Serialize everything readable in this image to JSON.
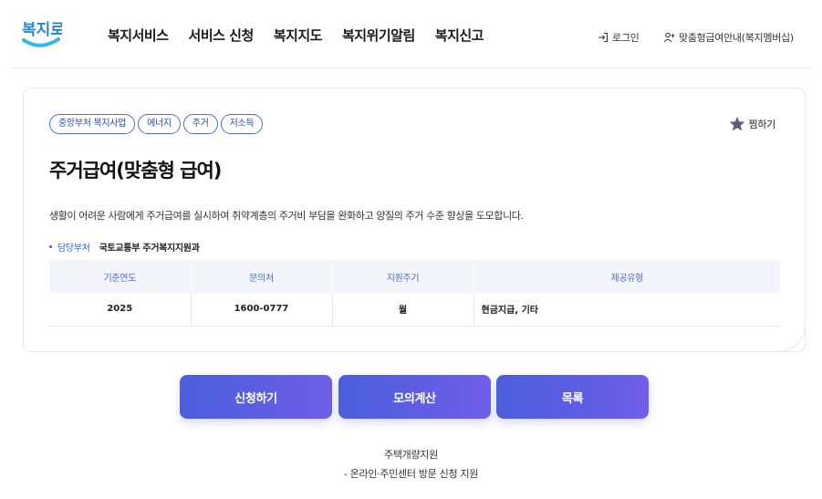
{
  "header": {
    "logo_text": "복지로",
    "nav": [
      "복지서비스",
      "서비스 신청",
      "복지지도",
      "복지위기알림",
      "복지신고"
    ],
    "login_label": "로그인",
    "guide_label": "맞춤형급여안내(복지멤버십)",
    "icons": {
      "login": "login-icon",
      "guide": "user-add-icon"
    }
  },
  "card": {
    "tags": [
      "중앙부처 복지사업",
      "에너지",
      "주거",
      "저소득"
    ],
    "bookmark_label": "찜하기",
    "title": "주거급여(맞춤형 급여)",
    "description": "생활이 어려운 사람에게 주거급여를 실시하여 취약계층의 주거비 부담을 완화하고 양질의 주거 수준 향상을 도모합니다.",
    "dept_label": "담당부처",
    "dept_value": "국토교통부 주거복지지원과",
    "table": {
      "headers": [
        "기준연도",
        "문의처",
        "지원주기",
        "제공유형"
      ],
      "row": [
        "2025",
        "1600-0777",
        "월",
        "현금지급, 기타"
      ]
    }
  },
  "buttons": {
    "apply": "신청하기",
    "calc": "모의계산",
    "list": "목록"
  },
  "bottom": {
    "line1": "주택개량지원",
    "line2": "- 온라인·주민센터 방문 신청 지원"
  },
  "colors": {
    "accent": "#4a6cd4",
    "button_start": "#4a5fdc",
    "button_end": "#6f5ee8",
    "logo_blue": "#1a8fd8"
  }
}
